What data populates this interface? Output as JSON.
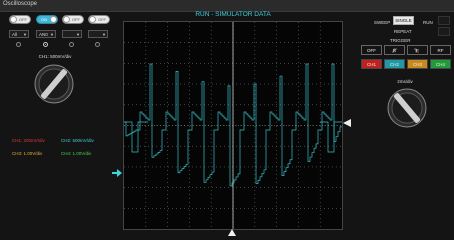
{
  "window": {
    "title": "Oscilloscope"
  },
  "toggles": [
    {
      "label": "OFF",
      "on": false
    },
    {
      "label": "ON",
      "on": true
    },
    {
      "label": "OFF",
      "on": false
    },
    {
      "label": "OFF",
      "on": false
    }
  ],
  "selects": [
    {
      "value": "All"
    },
    {
      "value": "AN0"
    },
    {
      "value": ""
    },
    {
      "value": ""
    }
  ],
  "left": {
    "knob_label": "CH1: 500mV/div",
    "channels": [
      {
        "text": "CH1: 200mV/div",
        "color": "#e23b3b"
      },
      {
        "text": "CH2: 500mV/div",
        "color": "#3fd3e0"
      },
      {
        "text": "CH3: 1.00V/div",
        "color": "#e0b22e"
      },
      {
        "text": "CH4: 1.00V/div",
        "color": "#3fd64a"
      }
    ]
  },
  "screen": {
    "title": "RUN - SIMULATOR DATA",
    "trace_color": "#37c0c8"
  },
  "right": {
    "sweep_label": "SWEEP",
    "single_label": "SINGLE",
    "repeat_label": "REPEAT",
    "run_label": "RUN",
    "trigger_label": "TRIGGER",
    "trigger_buttons": [
      "OFF",
      "R",
      "F",
      "RF"
    ],
    "channel_buttons": [
      {
        "label": "CH1",
        "color": "#c0201e"
      },
      {
        "label": "CH2",
        "color": "#1e9aa6"
      },
      {
        "label": "CH3",
        "color": "#c88a1e"
      },
      {
        "label": "CH4",
        "color": "#239a3a"
      }
    ],
    "knob_label": "2ms/div"
  }
}
